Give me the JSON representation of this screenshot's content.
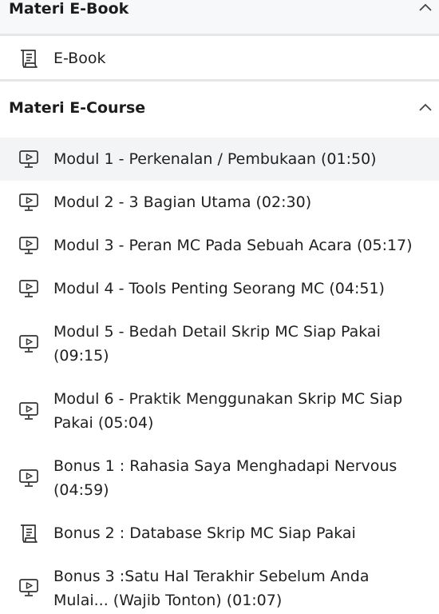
{
  "sections": [
    {
      "title": "Materi E-Book",
      "items": [
        {
          "label": "E-Book",
          "icon": "scroll-icon"
        }
      ]
    },
    {
      "title": "Materi E-Course",
      "items": [
        {
          "label": "Modul 1 - Perkenalan / Pembukaan (01:50)",
          "icon": "video-lesson-icon",
          "active": true
        },
        {
          "label": "Modul 2 - 3 Bagian Utama (02:30)",
          "icon": "video-lesson-icon"
        },
        {
          "label": "Modul 3 - Peran MC Pada Sebuah Acara (05:17)",
          "icon": "video-lesson-icon"
        },
        {
          "label": "Modul 4 - Tools Penting Seorang MC (04:51)",
          "icon": "video-lesson-icon"
        },
        {
          "label": "Modul 5 - Bedah Detail Skrip MC Siap Pakai (09:15)",
          "icon": "video-lesson-icon"
        },
        {
          "label": "Modul 6 - Praktik Menggunakan Skrip MC Siap Pakai (05:04)",
          "icon": "video-lesson-icon"
        },
        {
          "label": "Bonus 1 : Rahasia Saya Menghadapi Nervous (04:59)",
          "icon": "video-lesson-icon"
        },
        {
          "label": "Bonus 2 : Database Skrip MC Siap Pakai",
          "icon": "scroll-icon"
        },
        {
          "label": "Bonus 3 :Satu Hal Terakhir Sebelum Anda Mulai... (Wajib Tonton) (01:07)",
          "icon": "video-lesson-icon"
        }
      ]
    }
  ],
  "colors": {
    "accent_line": "#3aa0a8",
    "active_bg": "#f3f4f6",
    "header_bg": "#f7f8fa"
  }
}
